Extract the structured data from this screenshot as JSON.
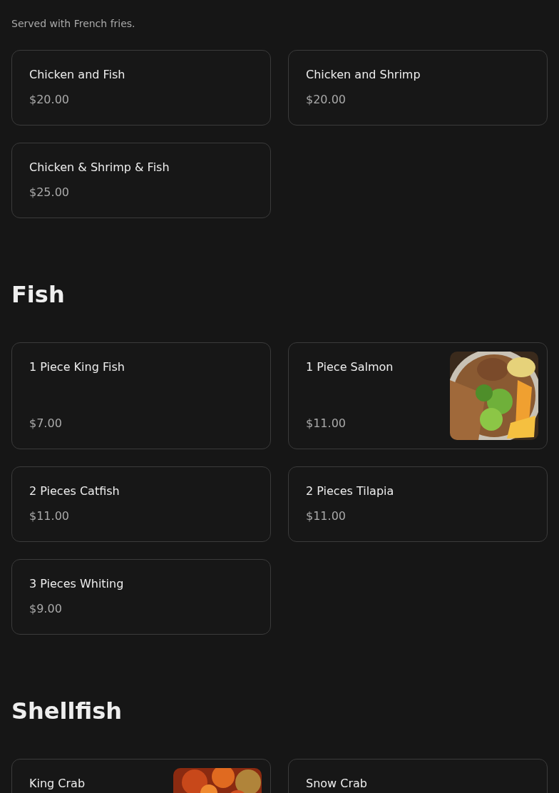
{
  "sections": [
    {
      "note": "Served with French fries.",
      "items": [
        {
          "name": "Chicken and Fish",
          "price": "$20.00",
          "kind": "plain"
        },
        {
          "name": "Chicken and Shrimp",
          "price": "$20.00",
          "kind": "plain"
        },
        {
          "name": "Chicken & Shrimp & Fish",
          "price": "$25.00",
          "kind": "plain"
        }
      ]
    },
    {
      "title": "Fish",
      "items": [
        {
          "name": "1 Piece King Fish",
          "price": "$7.00",
          "kind": "plain"
        },
        {
          "name": "1 Piece Salmon",
          "price": "$11.00"
        },
        {
          "name": "2 Pieces Catfish",
          "price": "$11.00",
          "kind": "plain"
        },
        {
          "name": "2 Pieces Tilapia",
          "price": "$11.00",
          "kind": "plain"
        },
        {
          "name": "3 Pieces Whiting",
          "price": "$9.00",
          "kind": "plain"
        }
      ]
    },
    {
      "title": "Shellfish",
      "items": [
        {
          "name": "King Crab"
        },
        {
          "name": "Snow Crab",
          "kind": "plain"
        }
      ]
    }
  ]
}
